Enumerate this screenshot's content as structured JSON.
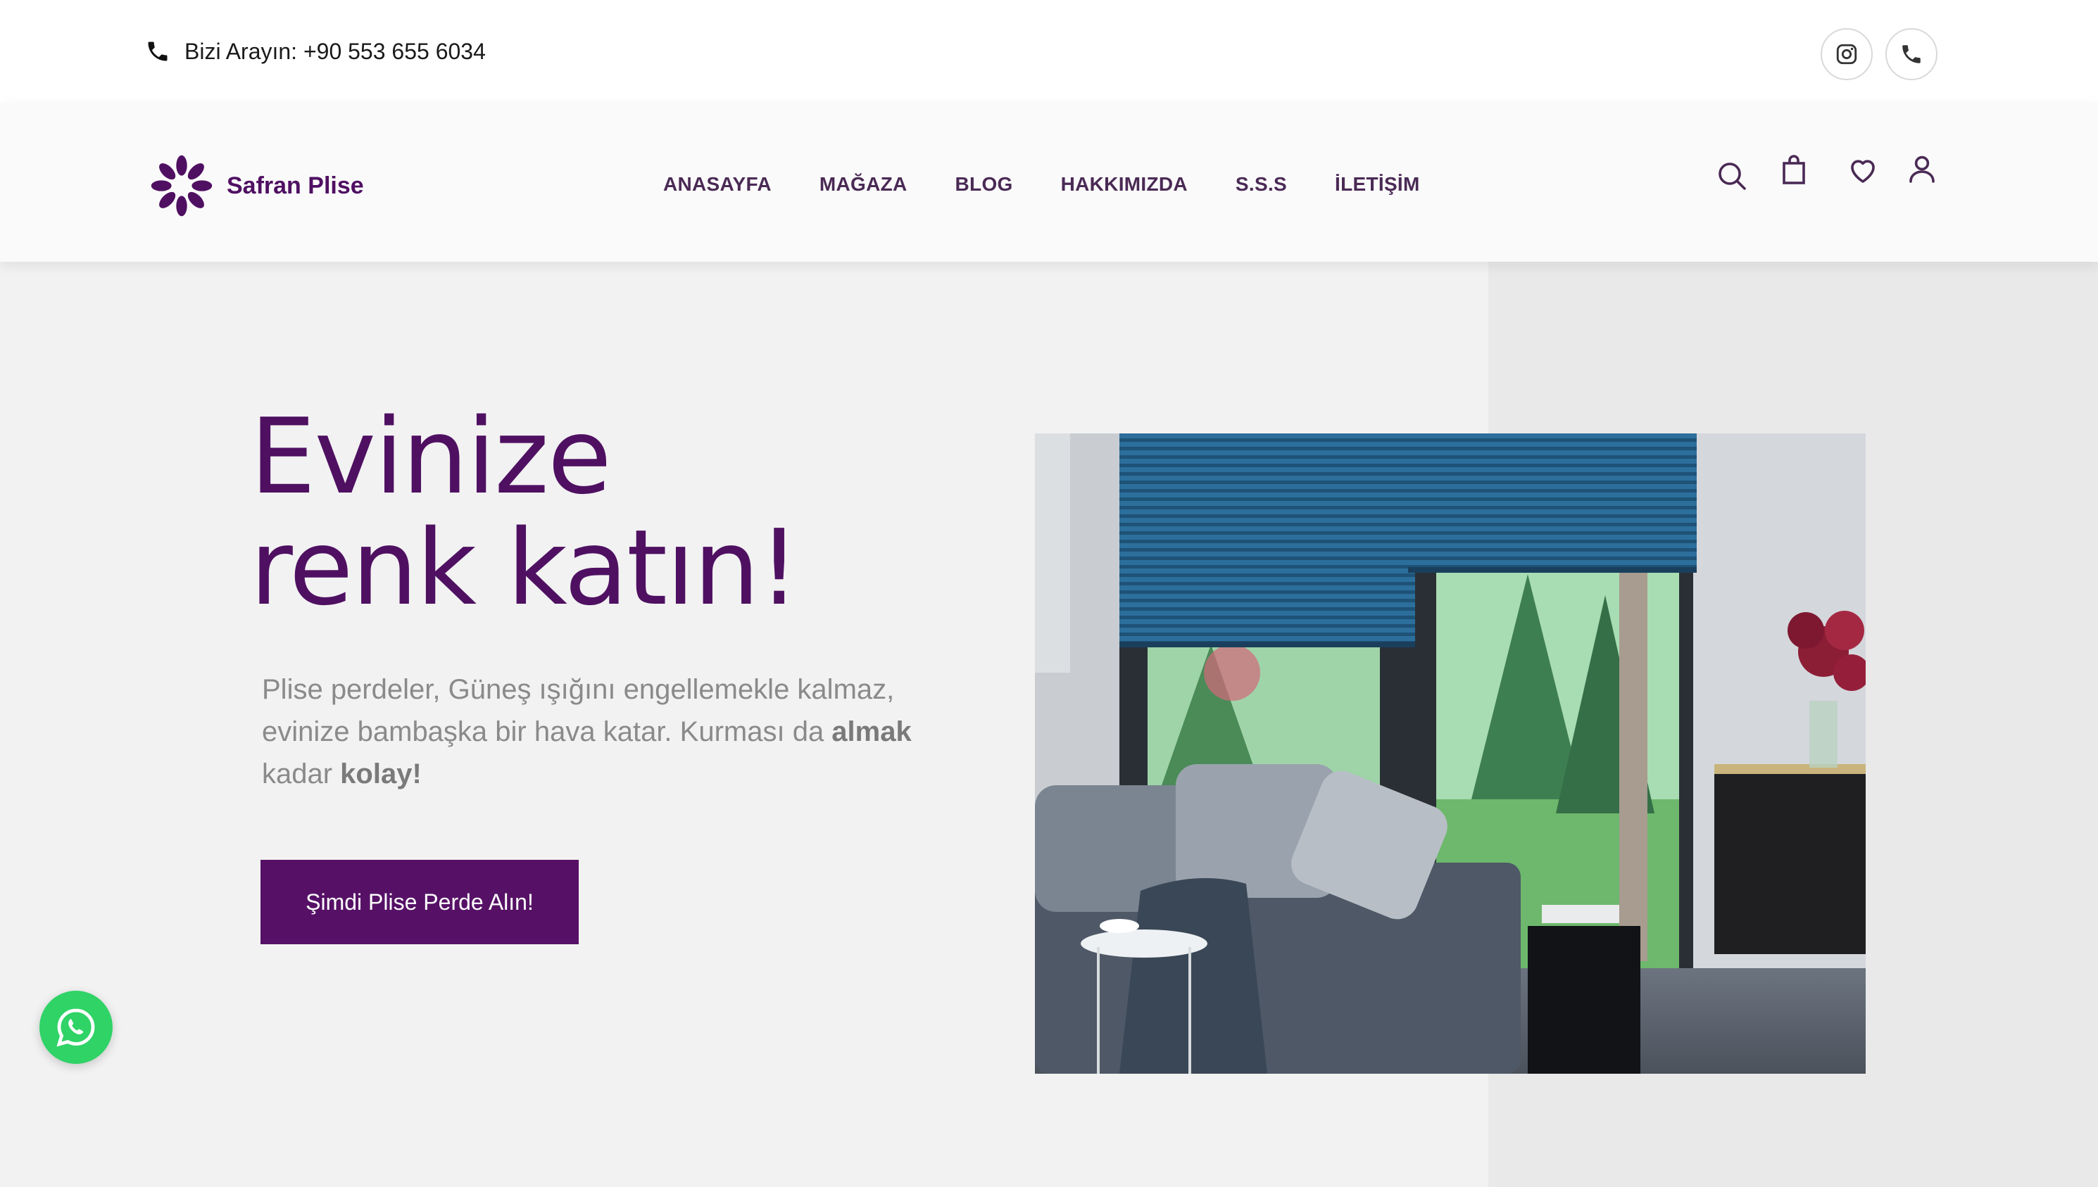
{
  "topbar": {
    "call_text": "Bizi Arayın: +90 553 655 6034",
    "icons": [
      "phone-icon",
      "instagram-icon",
      "phone-icon"
    ]
  },
  "header": {
    "brand": "Safran Plise",
    "nav": [
      "ANASAYFA",
      "MAĞAZA",
      "BLOG",
      "HAKKIMIZDA",
      "S.S.S",
      "İLETİŞİM"
    ],
    "icons": [
      "search-icon",
      "shopping-bag-icon",
      "heart-icon",
      "user-icon"
    ]
  },
  "hero": {
    "title_line1": "Evinize",
    "title_line2": "renk katın!",
    "text_part1": "Plise perdeler, Güneş ışığını engellemekle kalmaz, evinize bambaşka bir hava katar. Kurması da ",
    "text_bold1": "almak",
    "text_part2": " kadar ",
    "text_bold2": "kolay!",
    "cta_label": "Şimdi Plise Perde Alın!"
  },
  "floating": {
    "icon": "whatsapp-icon"
  },
  "colors": {
    "brand": "#561166",
    "nav_text": "#4a2a55",
    "whatsapp": "#2fd366",
    "page_bg": "#f2f2f2"
  }
}
